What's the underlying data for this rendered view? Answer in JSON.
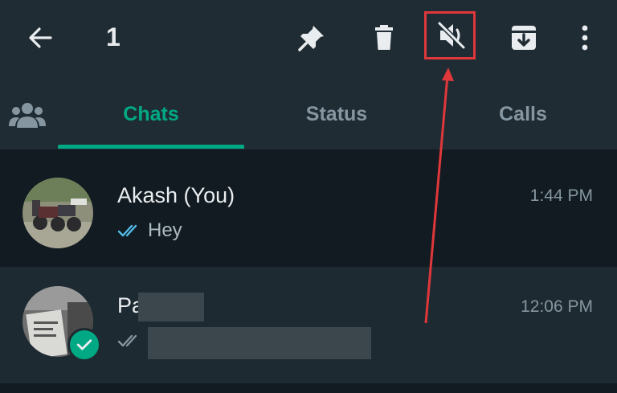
{
  "header": {
    "selected_count": "1",
    "icons": [
      "back-arrow-icon",
      "pin-icon",
      "delete-icon",
      "mute-icon",
      "archive-icon",
      "more-options-icon"
    ],
    "highlight_color": "#e0373a"
  },
  "tabs": {
    "items": [
      {
        "label": "Chats",
        "active": true
      },
      {
        "label": "Status",
        "active": false
      },
      {
        "label": "Calls",
        "active": false
      }
    ],
    "accent": "#00a884"
  },
  "chats": [
    {
      "name": "Akash (You)",
      "time": "1:44 PM",
      "preview": "Hey",
      "ticks": "read",
      "tick_color": "#53bdeb"
    },
    {
      "name": "Pa",
      "time": "12:06 PM",
      "preview": "",
      "ticks": "delivered",
      "tick_color": "#8696a0",
      "selected": true
    }
  ]
}
